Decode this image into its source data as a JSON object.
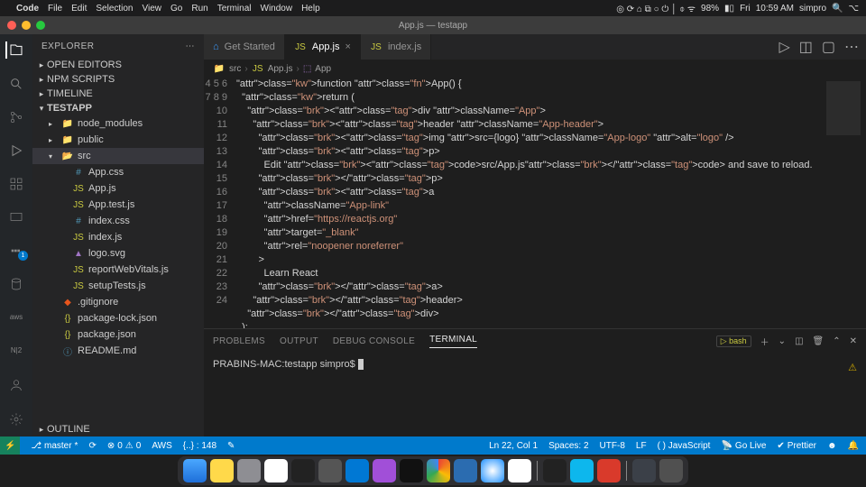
{
  "menubar": {
    "app": "Code",
    "items": [
      "File",
      "Edit",
      "Selection",
      "View",
      "Go",
      "Run",
      "Terminal",
      "Window",
      "Help"
    ],
    "right": {
      "battery": "98%",
      "day": "Fri",
      "time": "10:59 AM",
      "user": "simpro"
    }
  },
  "window": {
    "title": "App.js — testapp"
  },
  "sidebar": {
    "title": "EXPLORER",
    "sections": {
      "openEditors": "OPEN EDITORS",
      "npm": "NPM SCRIPTS",
      "timeline": "TIMELINE",
      "outline": "OUTLINE",
      "project": "TESTAPP"
    },
    "tree": [
      {
        "label": "node_modules",
        "kind": "folder",
        "indent": 1,
        "open": false
      },
      {
        "label": "public",
        "kind": "folder",
        "indent": 1,
        "open": false
      },
      {
        "label": "src",
        "kind": "folder",
        "indent": 1,
        "open": true,
        "sel": true
      },
      {
        "label": "App.css",
        "kind": "css",
        "indent": 2
      },
      {
        "label": "App.js",
        "kind": "js",
        "indent": 2
      },
      {
        "label": "App.test.js",
        "kind": "js",
        "indent": 2
      },
      {
        "label": "index.css",
        "kind": "css",
        "indent": 2
      },
      {
        "label": "index.js",
        "kind": "js",
        "indent": 2
      },
      {
        "label": "logo.svg",
        "kind": "svg",
        "indent": 2
      },
      {
        "label": "reportWebVitals.js",
        "kind": "js",
        "indent": 2
      },
      {
        "label": "setupTests.js",
        "kind": "js",
        "indent": 2
      },
      {
        "label": ".gitignore",
        "kind": "git",
        "indent": 1
      },
      {
        "label": "package-lock.json",
        "kind": "json",
        "indent": 1
      },
      {
        "label": "package.json",
        "kind": "json",
        "indent": 1
      },
      {
        "label": "README.md",
        "kind": "md",
        "indent": 1
      }
    ]
  },
  "tabs": [
    {
      "label": "Get Started",
      "icon": "vs",
      "active": false
    },
    {
      "label": "App.js",
      "icon": "js",
      "active": true
    },
    {
      "label": "index.js",
      "icon": "js",
      "active": false
    }
  ],
  "breadcrumb": [
    "src",
    "App.js",
    "App"
  ],
  "code": {
    "start": 4,
    "lines": [
      "function App() {",
      "  return (",
      "    <div className=\"App\">",
      "      <header className=\"App-header\">",
      "        <img src={logo} className=\"App-logo\" alt=\"logo\" />",
      "        <p>",
      "          Edit <code>src/App.js</code> and save to reload.",
      "        </p>",
      "        <a",
      "          className=\"App-link\"",
      "          href=\"https://reactjs.org\"",
      "          target=\"_blank\"",
      "          rel=\"noopener noreferrer\"",
      "        >",
      "          Learn React",
      "        </a>",
      "      </header>",
      "    </div>",
      "  );",
      "}",
      ""
    ]
  },
  "panel": {
    "tabs": [
      "PROBLEMS",
      "OUTPUT",
      "DEBUG CONSOLE",
      "TERMINAL"
    ],
    "active": 3,
    "shell": "bash",
    "prompt": "PRABINS-MAC:testapp simpro$ "
  },
  "status": {
    "branch": "master",
    "sync": "",
    "errors": "0",
    "warnings": "0",
    "aws": "AWS",
    "scope": "{..} : 148",
    "pos": "Ln 22, Col 1",
    "spaces": "Spaces: 2",
    "enc": "UTF-8",
    "eol": "LF",
    "lang": "( ) JavaScript",
    "golive": "Go Live",
    "prettier": "Prettier"
  }
}
